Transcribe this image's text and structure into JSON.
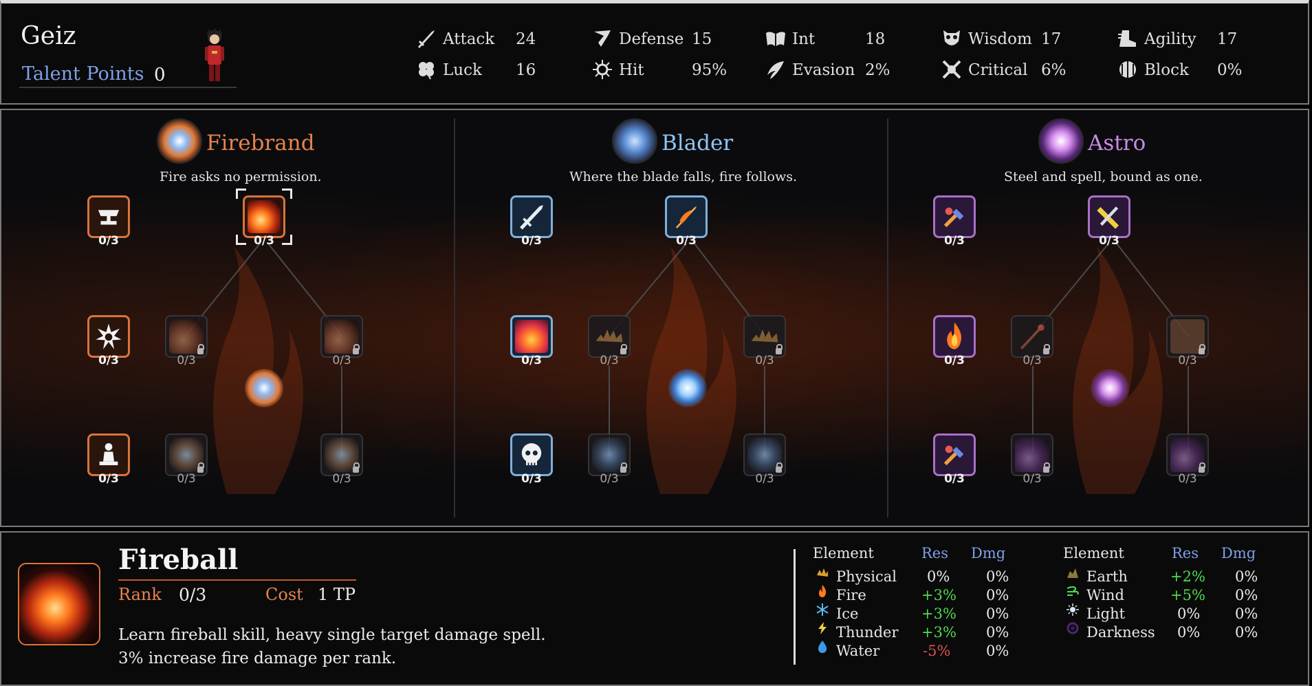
{
  "character": {
    "name": "Geiz",
    "talent_points_label": "Talent Points",
    "talent_points": "0"
  },
  "stats": [
    {
      "label": "Attack",
      "value": "24",
      "icon": "sword-icon"
    },
    {
      "label": "Luck",
      "value": "16",
      "icon": "clover-icon"
    },
    {
      "label": "Defense",
      "value": "15",
      "icon": "shield-icon"
    },
    {
      "label": "Hit",
      "value": "95%",
      "icon": "target-icon"
    },
    {
      "label": "Int",
      "value": "18",
      "icon": "book-icon"
    },
    {
      "label": "Evasion",
      "value": "2%",
      "icon": "wing-icon"
    },
    {
      "label": "Wisdom",
      "value": "17",
      "icon": "owl-icon"
    },
    {
      "label": "Critical",
      "value": "6%",
      "icon": "critical-icon"
    },
    {
      "label": "Agility",
      "value": "17",
      "icon": "boot-icon"
    },
    {
      "label": "Block",
      "value": "0%",
      "icon": "block-icon"
    }
  ],
  "trees": [
    {
      "name": "Firebrand",
      "description": "Fire asks no permission.",
      "color": "#e8834c",
      "nodes": [
        {
          "rank": "0/3",
          "state": "active",
          "icon": "anvil-icon"
        },
        {
          "rank": "0/3",
          "state": "active",
          "icon": "fireball-icon",
          "selected": true
        },
        {
          "rank": "0/3",
          "state": "active",
          "icon": "burst-icon"
        },
        {
          "rank": "0/3",
          "state": "locked",
          "icon": "fireball-icon"
        },
        {
          "rank": "0/3",
          "state": "locked",
          "icon": "fireball-icon"
        },
        {
          "rank": "0/3",
          "state": "active",
          "icon": "meditate-icon"
        },
        {
          "rank": "0/3",
          "state": "locked",
          "icon": "orb-icon"
        },
        {
          "rank": "0/3",
          "state": "locked",
          "icon": "orb-icon"
        }
      ]
    },
    {
      "name": "Blader",
      "description": "Where the blade falls, fire follows.",
      "color": "#8fc4f2",
      "nodes": [
        {
          "rank": "0/3",
          "state": "active",
          "icon": "blade-icon"
        },
        {
          "rank": "0/3",
          "state": "active",
          "icon": "flame-sword-icon"
        },
        {
          "rank": "0/3",
          "state": "active",
          "icon": "heart-flame-icon"
        },
        {
          "rank": "0/3",
          "state": "locked",
          "icon": "spike-icon"
        },
        {
          "rank": "0/3",
          "state": "locked",
          "icon": "spike-icon"
        },
        {
          "rank": "0/3",
          "state": "active",
          "icon": "skull-icon"
        },
        {
          "rank": "0/3",
          "state": "locked",
          "icon": "sword-burst-icon"
        },
        {
          "rank": "0/3",
          "state": "locked",
          "icon": "sword-burst-icon"
        }
      ]
    },
    {
      "name": "Astro",
      "description": "Steel and spell, bound as one.",
      "color": "#c98be8",
      "nodes": [
        {
          "rank": "0/3",
          "state": "active",
          "icon": "wrench-icon"
        },
        {
          "rank": "0/3",
          "state": "active",
          "icon": "crossed-swords-icon"
        },
        {
          "rank": "0/3",
          "state": "active",
          "icon": "flame-icon"
        },
        {
          "rank": "0/3",
          "state": "locked",
          "icon": "staff-icon"
        },
        {
          "rank": "0/3",
          "state": "locked",
          "icon": "shield-icon"
        },
        {
          "rank": "0/3",
          "state": "active",
          "icon": "wrench-icon"
        },
        {
          "rank": "0/3",
          "state": "locked",
          "icon": "meteor-icon"
        },
        {
          "rank": "0/3",
          "state": "locked",
          "icon": "meteor-icon"
        }
      ]
    }
  ],
  "selected_skill": {
    "name": "Fireball",
    "rank_label": "Rank",
    "rank": "0/3",
    "cost_label": "Cost",
    "cost": "1 TP",
    "description_line1": "Learn fireball skill, heavy single target damage spell.",
    "description_line2": "3% increase fire damage per rank."
  },
  "elements_left": {
    "header": {
      "element": "Element",
      "res": "Res",
      "dmg": "Dmg"
    },
    "rows": [
      {
        "name": "Physical",
        "res": "0%",
        "dmg": "0%",
        "icon": "physical-icon"
      },
      {
        "name": "Fire",
        "res": "+3%",
        "dmg": "0%",
        "icon": "fire-icon"
      },
      {
        "name": "Ice",
        "res": "+3%",
        "dmg": "0%",
        "icon": "ice-icon"
      },
      {
        "name": "Thunder",
        "res": "+3%",
        "dmg": "0%",
        "icon": "thunder-icon"
      },
      {
        "name": "Water",
        "res": "-5%",
        "dmg": "0%",
        "icon": "water-icon"
      }
    ]
  },
  "elements_right": {
    "header": {
      "element": "Element",
      "res": "Res",
      "dmg": "Dmg"
    },
    "rows": [
      {
        "name": "Earth",
        "res": "+2%",
        "dmg": "0%",
        "icon": "earth-icon"
      },
      {
        "name": "Wind",
        "res": "+5%",
        "dmg": "0%",
        "icon": "wind-icon"
      },
      {
        "name": "Light",
        "res": "0%",
        "dmg": "0%",
        "icon": "light-icon"
      },
      {
        "name": "Darkness",
        "res": "0%",
        "dmg": "0%",
        "icon": "darkness-icon"
      }
    ]
  },
  "colors": {
    "firebrand": "#e8834c",
    "blader": "#8fc4f2",
    "astro": "#c98be8",
    "positive": "#4fdc4f",
    "negative": "#e05050",
    "header_blue": "#7fa0e8"
  }
}
